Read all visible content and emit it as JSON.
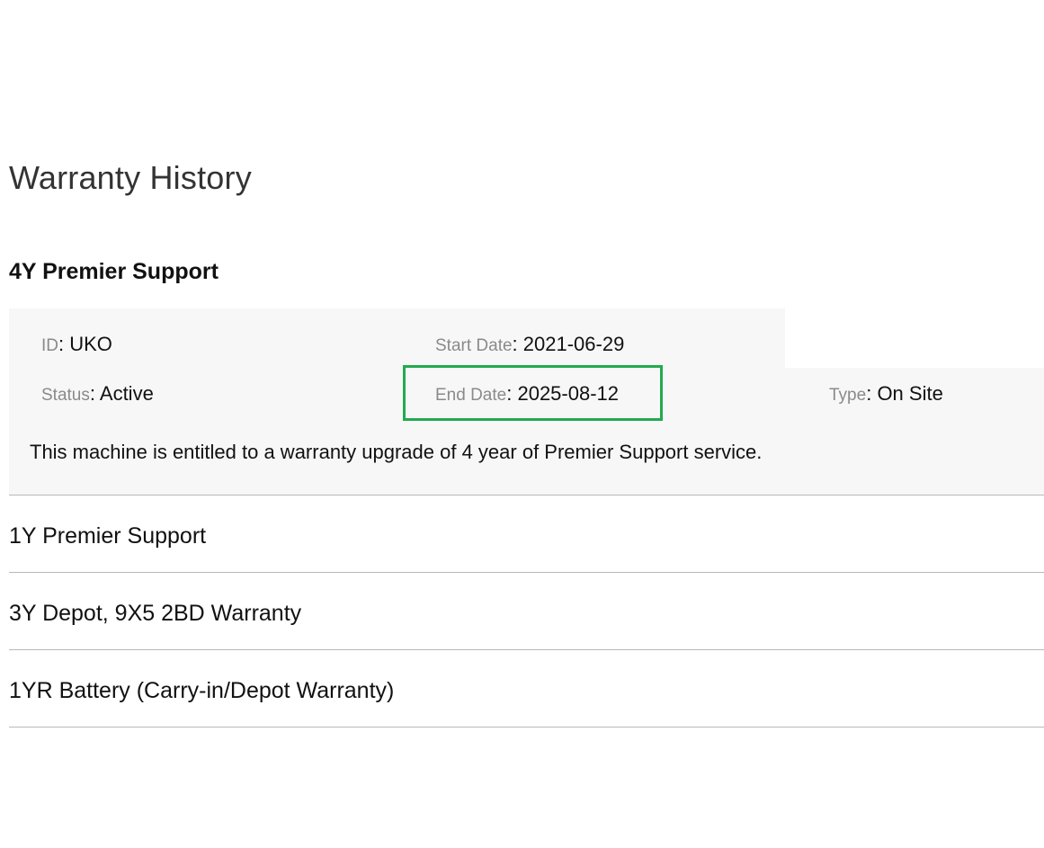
{
  "page": {
    "title": "Warranty History"
  },
  "expanded_item": {
    "heading": "4Y Premier Support",
    "fields": {
      "id": {
        "label": "ID",
        "value": "UKO"
      },
      "start_date": {
        "label": "Start Date",
        "value": "2021-06-29"
      },
      "status": {
        "label": "Status",
        "value": "Active"
      },
      "end_date": {
        "label": "End Date",
        "value": "2025-08-12"
      },
      "type": {
        "label": "Type",
        "value": "On Site"
      }
    },
    "separator": ": ",
    "description": "This machine is entitled to a warranty upgrade of 4 year of Premier Support service."
  },
  "collapsed_items": [
    {
      "heading": "1Y Premier Support"
    },
    {
      "heading": "3Y Depot, 9X5 2BD Warranty"
    },
    {
      "heading": "1YR Battery (Carry-in/Depot Warranty)"
    }
  ],
  "colors": {
    "highlight_border": "#22aa4f",
    "panel_background": "#f7f7f7",
    "label_text": "#8a8a8a",
    "divider": "#b8b8b8"
  }
}
